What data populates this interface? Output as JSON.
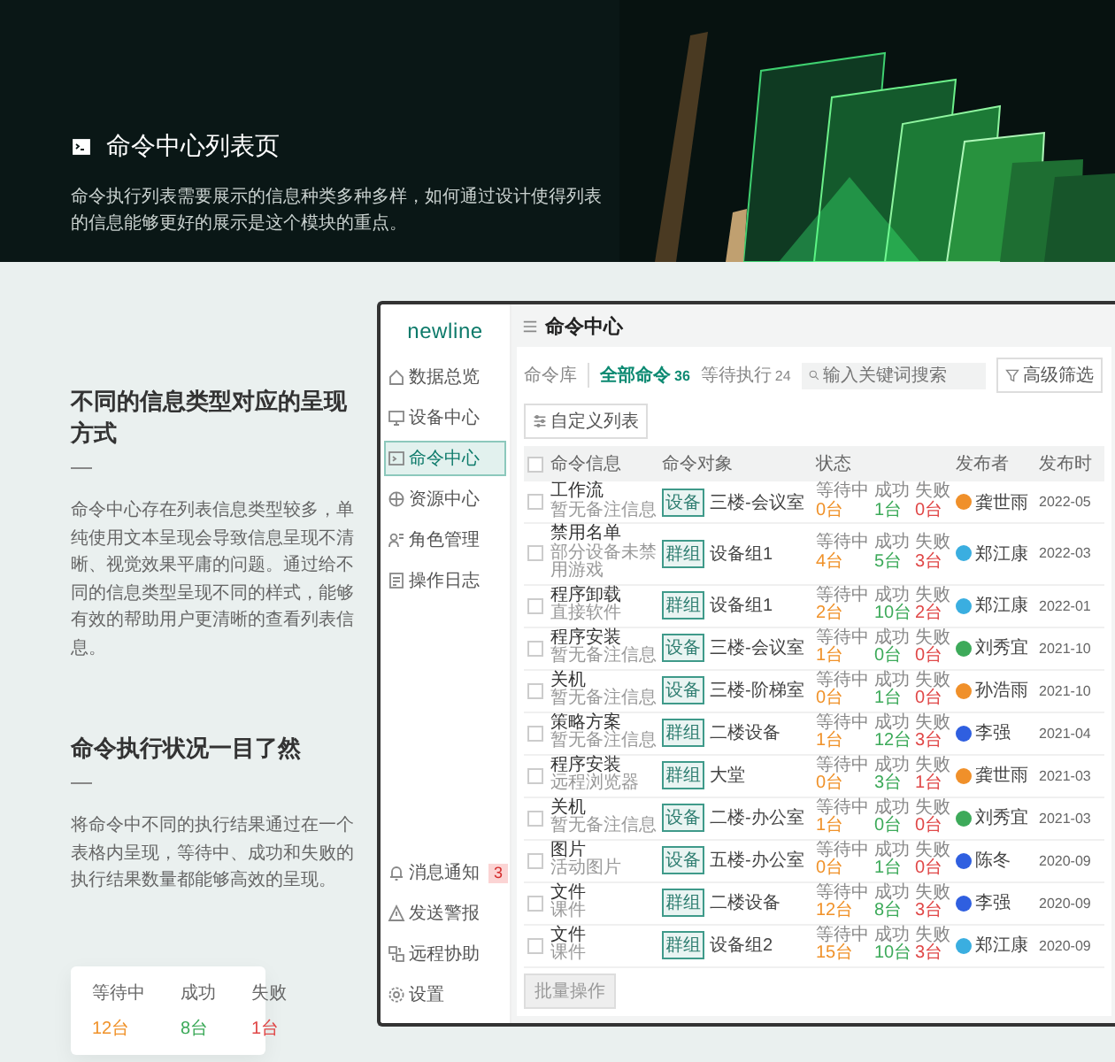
{
  "hero": {
    "title": "命令中心列表页",
    "description": "命令执行列表需要展示的信息种类多种多样，如何通过设计使得列表的信息能够更好的展示是这个模块的重点。"
  },
  "sections": [
    {
      "title": "不同的信息类型对应的呈现方式",
      "body": "命令中心存在列表信息类型较多，单纯使用文本呈现会导致信息呈现不清晰、视觉效果平庸的问题。通过给不同的信息类型呈现不同的样式，能够有效的帮助用户更清晰的查看列表信息。"
    },
    {
      "title": "命令执行状况一目了然",
      "body": "将命令中不同的执行结果通过在一个表格内呈现，等待中、成功和失败的执行结果数量都能够高效的呈现。"
    }
  ],
  "stat_card": [
    {
      "kind": "waiting",
      "label": "等待中",
      "value": "12台"
    },
    {
      "kind": "success",
      "label": "成功",
      "value": "8台"
    },
    {
      "kind": "failed",
      "label": "失败",
      "value": "1台"
    }
  ],
  "app": {
    "logo": "newline",
    "sidebar": {
      "items": [
        {
          "label": "数据总览",
          "selected": false
        },
        {
          "label": "设备中心",
          "selected": false
        },
        {
          "label": "命令中心",
          "selected": true
        },
        {
          "label": "资源中心",
          "selected": false
        },
        {
          "label": "角色管理",
          "selected": false
        },
        {
          "label": "操作日志",
          "selected": false
        }
      ],
      "bottom_items": [
        {
          "label": "消息通知",
          "badge": "3"
        },
        {
          "label": "发送警报"
        },
        {
          "label": "远程协助"
        },
        {
          "label": "设置"
        }
      ]
    },
    "page_title": "命令中心",
    "library_label": "命令库",
    "tabs": [
      {
        "label": "全部命令",
        "count": "36",
        "selected": true
      },
      {
        "label": "等待执行",
        "count": "24",
        "selected": false
      }
    ],
    "search": {
      "placeholder": "输入关键词搜索"
    },
    "buttons": [
      "高级筛选",
      "自定义列表"
    ],
    "all_checked": false,
    "columns": [
      "命令信息",
      "命令对象",
      "状态",
      "发布者",
      "发布时"
    ],
    "rows": [
      {
        "checked": false,
        "name": "工作流",
        "note": "暂无备注信息",
        "tag": "设备",
        "target": "三楼-会议室",
        "status": [
          {
            "kind": "waiting",
            "label": "等待中",
            "value": "0台"
          },
          {
            "kind": "success",
            "label": "成功",
            "value": "1台"
          },
          {
            "kind": "failed",
            "label": "失败",
            "value": "0台"
          }
        ],
        "publisher": "龚世雨",
        "color": "#f0902a",
        "time": "2022-05"
      },
      {
        "checked": false,
        "name": "禁用名单",
        "note": "部分设备未禁用游戏",
        "tag": "群组",
        "target": "设备组1",
        "status": [
          {
            "kind": "waiting",
            "label": "等待中",
            "value": "4台"
          },
          {
            "kind": "success",
            "label": "成功",
            "value": "5台"
          },
          {
            "kind": "failed",
            "label": "失败",
            "value": "3台"
          }
        ],
        "publisher": "郑江康",
        "color": "#3aaee0",
        "time": "2022-03"
      },
      {
        "checked": false,
        "name": "程序卸载",
        "note": "直接软件",
        "tag": "群组",
        "target": "设备组1",
        "status": [
          {
            "kind": "waiting",
            "label": "等待中",
            "value": "2台"
          },
          {
            "kind": "success",
            "label": "成功",
            "value": "10台"
          },
          {
            "kind": "failed",
            "label": "失败",
            "value": "2台"
          }
        ],
        "publisher": "郑江康",
        "color": "#3aaee0",
        "time": "2022-01"
      },
      {
        "checked": false,
        "name": "程序安装",
        "note": "暂无备注信息",
        "tag": "设备",
        "target": "三楼-会议室",
        "status": [
          {
            "kind": "waiting",
            "label": "等待中",
            "value": "1台"
          },
          {
            "kind": "success",
            "label": "成功",
            "value": "0台"
          },
          {
            "kind": "failed",
            "label": "失败",
            "value": "0台"
          }
        ],
        "publisher": "刘秀宜",
        "color": "#3daa5a",
        "time": "2021-10"
      },
      {
        "checked": false,
        "name": "关机",
        "note": "暂无备注信息",
        "tag": "设备",
        "target": "三楼-阶梯室",
        "status": [
          {
            "kind": "waiting",
            "label": "等待中",
            "value": "0台"
          },
          {
            "kind": "success",
            "label": "成功",
            "value": "1台"
          },
          {
            "kind": "failed",
            "label": "失败",
            "value": "0台"
          }
        ],
        "publisher": "孙浩雨",
        "color": "#f0902a",
        "time": "2021-10"
      },
      {
        "checked": false,
        "name": "策略方案",
        "note": "暂无备注信息",
        "tag": "群组",
        "target": "二楼设备",
        "status": [
          {
            "kind": "waiting",
            "label": "等待中",
            "value": "1台"
          },
          {
            "kind": "success",
            "label": "成功",
            "value": "12台"
          },
          {
            "kind": "failed",
            "label": "失败",
            "value": "3台"
          }
        ],
        "publisher": "李强",
        "color": "#2f5fe0",
        "time": "2021-04"
      },
      {
        "checked": false,
        "name": "程序安装",
        "note": "远程浏览器",
        "tag": "群组",
        "target": "大堂",
        "status": [
          {
            "kind": "waiting",
            "label": "等待中",
            "value": "0台"
          },
          {
            "kind": "success",
            "label": "成功",
            "value": "3台"
          },
          {
            "kind": "failed",
            "label": "失败",
            "value": "1台"
          }
        ],
        "publisher": "龚世雨",
        "color": "#f0902a",
        "time": "2021-03"
      },
      {
        "checked": false,
        "name": "关机",
        "note": "暂无备注信息",
        "tag": "设备",
        "target": "二楼-办公室",
        "status": [
          {
            "kind": "waiting",
            "label": "等待中",
            "value": "1台"
          },
          {
            "kind": "success",
            "label": "成功",
            "value": "0台"
          },
          {
            "kind": "failed",
            "label": "失败",
            "value": "0台"
          }
        ],
        "publisher": "刘秀宜",
        "color": "#3daa5a",
        "time": "2021-03"
      },
      {
        "checked": false,
        "name": "图片",
        "note": "活动图片",
        "tag": "设备",
        "target": "五楼-办公室",
        "status": [
          {
            "kind": "waiting",
            "label": "等待中",
            "value": "0台"
          },
          {
            "kind": "success",
            "label": "成功",
            "value": "1台"
          },
          {
            "kind": "failed",
            "label": "失败",
            "value": "0台"
          }
        ],
        "publisher": "陈冬",
        "color": "#2f5fe0",
        "time": "2020-09"
      },
      {
        "checked": false,
        "name": "文件",
        "note": "课件",
        "tag": "群组",
        "target": "二楼设备",
        "status": [
          {
            "kind": "waiting",
            "label": "等待中",
            "value": "12台"
          },
          {
            "kind": "success",
            "label": "成功",
            "value": "8台"
          },
          {
            "kind": "failed",
            "label": "失败",
            "value": "3台"
          }
        ],
        "publisher": "李强",
        "color": "#2f5fe0",
        "time": "2020-09"
      },
      {
        "checked": false,
        "name": "文件",
        "note": "课件",
        "tag": "群组",
        "target": "设备组2",
        "status": [
          {
            "kind": "waiting",
            "label": "等待中",
            "value": "15台"
          },
          {
            "kind": "success",
            "label": "成功",
            "value": "10台"
          },
          {
            "kind": "failed",
            "label": "失败",
            "value": "3台"
          }
        ],
        "publisher": "郑江康",
        "color": "#3aaee0",
        "time": "2020-09"
      }
    ],
    "footer_button": "批量操作"
  }
}
